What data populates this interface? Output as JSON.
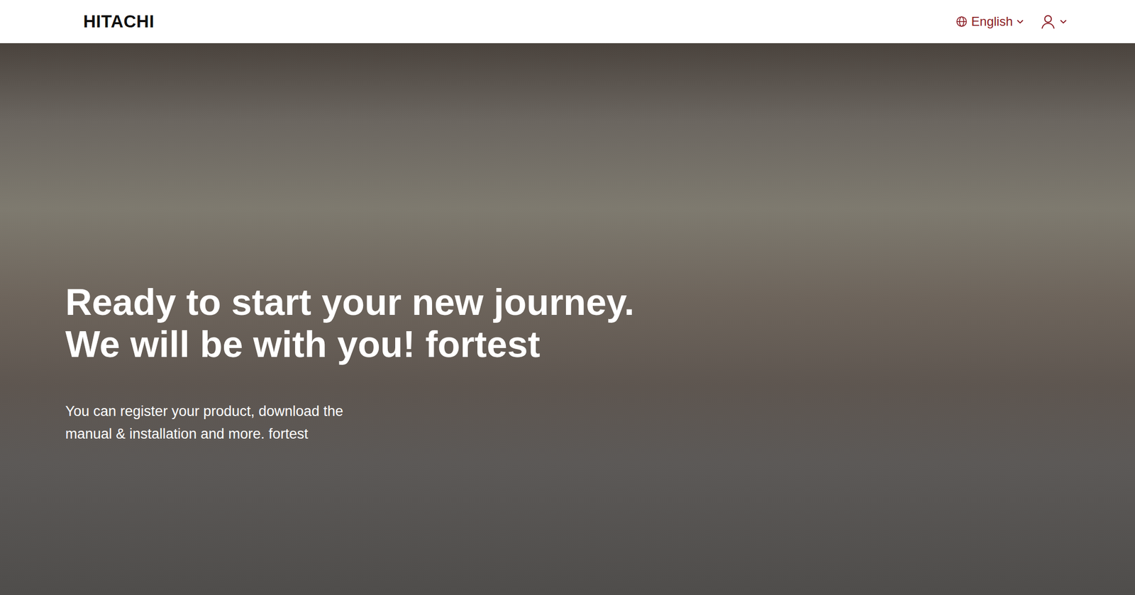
{
  "header": {
    "logo": "HITACHI",
    "language": "English"
  },
  "hero": {
    "title_lines": [
      "Ready to start your new journey.",
      "We will be with you! fortest"
    ],
    "subtitle": "You can register your product, download the manual & installation and more. fortest"
  }
}
